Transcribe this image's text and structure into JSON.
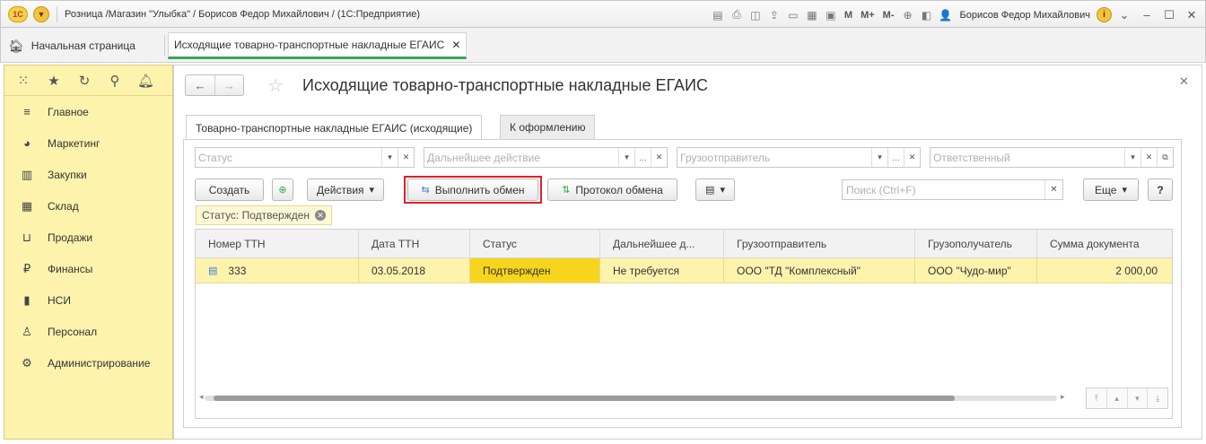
{
  "titlebar": {
    "logo": "1С",
    "title": "Розница /Магазин \"Улыбка\" / Борисов Федор Михайлович /  (1С:Предприятие)",
    "m_label": "M",
    "mplus_label": "M+",
    "mminus_label": "M-",
    "user": "Борисов Федор Михайлович",
    "info": "i"
  },
  "tabs": {
    "home_label": "Начальная страница",
    "active_label": "Исходящие товарно-транспортные накладные ЕГАИС"
  },
  "sidebar": {
    "items": [
      {
        "label": "Главное",
        "icon": "menu-icon"
      },
      {
        "label": "Маркетинг",
        "icon": "pie-chart-icon"
      },
      {
        "label": "Закупки",
        "icon": "purchases-icon"
      },
      {
        "label": "Склад",
        "icon": "warehouse-icon"
      },
      {
        "label": "Продажи",
        "icon": "basket-icon"
      },
      {
        "label": "Финансы",
        "icon": "ruble-icon"
      },
      {
        "label": "НСИ",
        "icon": "reference-book-icon"
      },
      {
        "label": "Персонал",
        "icon": "person-icon"
      },
      {
        "label": "Администрирование",
        "icon": "gear-icon"
      }
    ]
  },
  "page": {
    "title": "Исходящие товарно-транспортные накладные ЕГАИС",
    "form_tabs": [
      "Товарно-транспортные накладные ЕГАИС (исходящие)",
      "К оформлению"
    ]
  },
  "filters": {
    "status_placeholder": "Статус",
    "action_placeholder": "Дальнейшее действие",
    "shipper_placeholder": "Грузоотправитель",
    "responsible_placeholder": "Ответственный"
  },
  "toolbar": {
    "create_label": "Создать",
    "actions_label": "Действия",
    "exchange_label": "Выполнить обмен",
    "protocol_label": "Протокол обмена",
    "search_placeholder": "Поиск (Ctrl+F)",
    "more_label": "Еще",
    "help_label": "?"
  },
  "active_filter": {
    "label": "Статус: Подтвержден"
  },
  "table": {
    "columns": [
      "Номер ТТН",
      "Дата ТТН",
      "Статус",
      "Дальнейшее д...",
      "Грузоотправитель",
      "Грузополучатель",
      "Сумма документа"
    ],
    "rows": [
      {
        "number": "333",
        "date": "03.05.2018",
        "status": "Подтвержден",
        "next_action": "Не требуется",
        "shipper": "ООО \"ТД \"Комплексный\"",
        "consignee": "ООО \"Чудо-мир\"",
        "amount": "2 000,00"
      }
    ]
  },
  "colors": {
    "sidebar_bg": "#fdf3ad",
    "status_highlight": "#f7d51d",
    "highlight_border": "#e0202a",
    "active_tab_underline": "#3aa655"
  }
}
